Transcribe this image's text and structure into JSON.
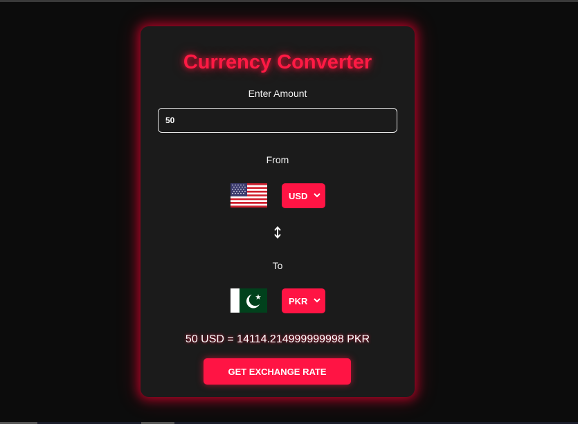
{
  "card": {
    "title": "Currency Converter",
    "amount_label": "Enter Amount",
    "amount_value": "50",
    "from_label": "From",
    "to_label": "To",
    "from_currency": "USD",
    "to_currency": "PKR",
    "from_flag": "us-flag-icon",
    "to_flag": "pk-flag-icon",
    "result_text": "50 USD = 14114.214999999998 PKR",
    "button_label": "GET EXCHANGE RATE"
  },
  "colors": {
    "accent": "#ff1444",
    "card_bg": "#1b1b1b",
    "page_bg": "#0c0c0c"
  }
}
